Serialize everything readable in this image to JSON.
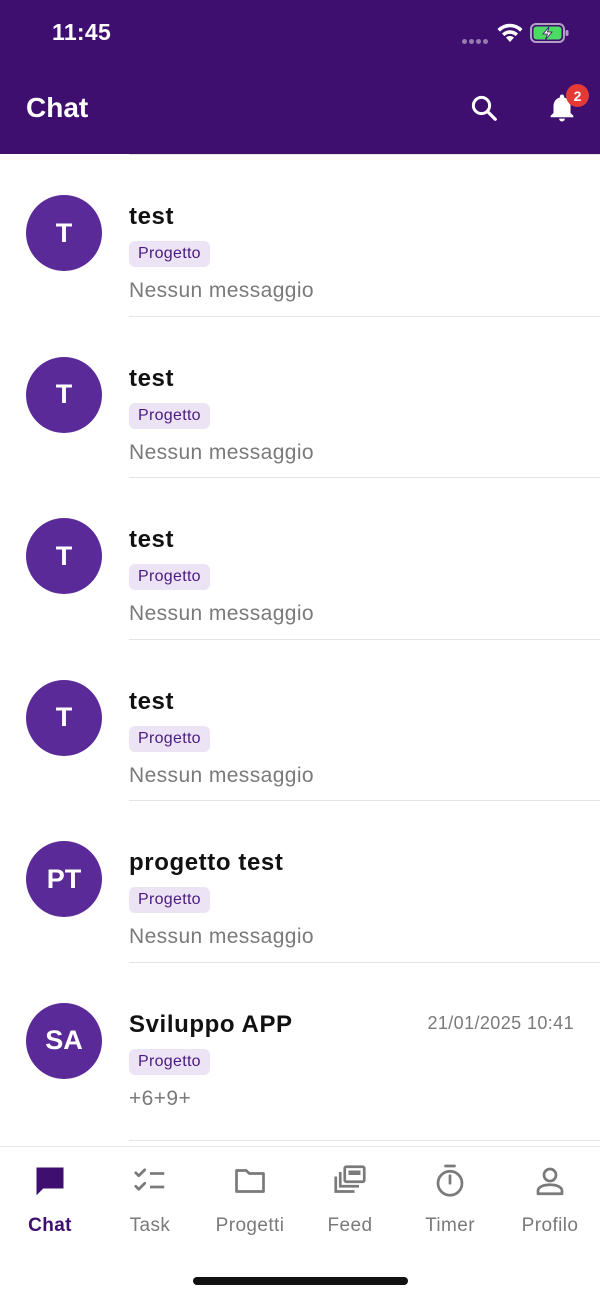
{
  "status_bar": {
    "time": "11:45"
  },
  "header": {
    "title": "Chat",
    "search_icon": "search-icon",
    "bell_icon": "bell-icon",
    "notification_count": "2"
  },
  "colors": {
    "primary": "#3f0f70",
    "avatar": "#5b2a99",
    "tag_bg": "#ece4f5",
    "badge": "#e53935"
  },
  "chats": [
    {
      "initials": "T",
      "name": "test",
      "tag": "Progetto",
      "preview": "Nessun messaggio",
      "time": ""
    },
    {
      "initials": "T",
      "name": "test",
      "tag": "Progetto",
      "preview": "Nessun messaggio",
      "time": ""
    },
    {
      "initials": "T",
      "name": "test",
      "tag": "Progetto",
      "preview": "Nessun messaggio",
      "time": ""
    },
    {
      "initials": "T",
      "name": "test",
      "tag": "Progetto",
      "preview": "Nessun messaggio",
      "time": ""
    },
    {
      "initials": "PT",
      "name": "progetto test",
      "tag": "Progetto",
      "preview": "Nessun messaggio",
      "time": ""
    },
    {
      "initials": "SA",
      "name": "Sviluppo APP",
      "tag": "Progetto",
      "preview": "+6+9+",
      "time": "21/01/2025 10:41"
    }
  ],
  "nav": [
    {
      "label": "Chat",
      "icon": "chat-icon",
      "active": true
    },
    {
      "label": "Task",
      "icon": "checklist-icon",
      "active": false
    },
    {
      "label": "Progetti",
      "icon": "folder-icon",
      "active": false
    },
    {
      "label": "Feed",
      "icon": "feed-icon",
      "active": false
    },
    {
      "label": "Timer",
      "icon": "timer-icon",
      "active": false
    },
    {
      "label": "Profilo",
      "icon": "person-icon",
      "active": false
    }
  ]
}
